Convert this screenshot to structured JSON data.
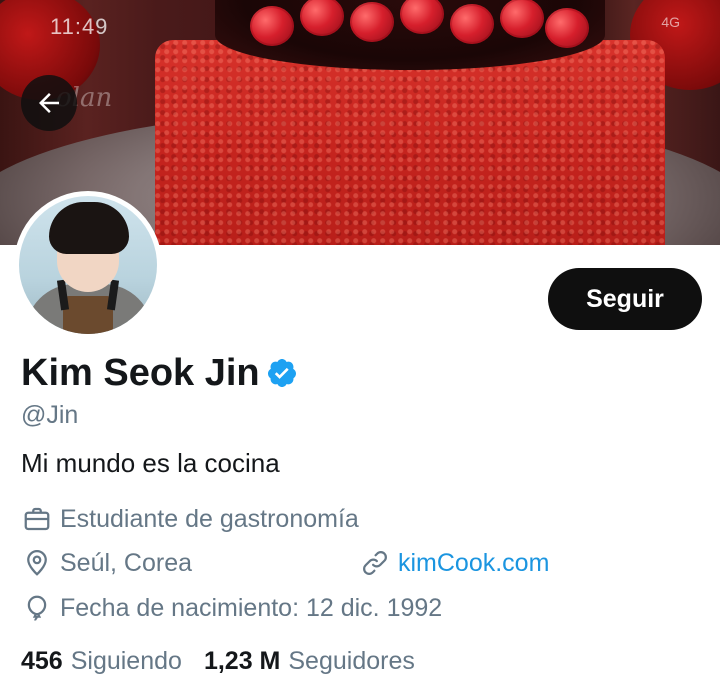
{
  "status_bar": {
    "time": "11:49",
    "signal": "4G"
  },
  "banner": {
    "watermark": "olan"
  },
  "header": {
    "back_icon": "arrow-left-icon"
  },
  "profile": {
    "name": "Kim Seok Jin",
    "verified_icon": "verified-badge-icon",
    "handle": "@Jin",
    "bio": "Mi mundo es la cocina",
    "follow_label": "Seguir",
    "occupation": "Estudiante de gastronomía",
    "location": "Seúl, Corea",
    "website": "kimCook.com",
    "birthdate": "Fecha de nacimiento: 12 dic. 1992"
  },
  "stats": {
    "following_count": "456",
    "following_label": "Siguiendo",
    "followers_count": "1,23 M",
    "followers_label": "Seguidores"
  },
  "colors": {
    "accent": "#1b95e0",
    "verified": "#1da1f2",
    "text_primary": "#14171a",
    "text_secondary": "#657786",
    "button_bg": "#0f0f0f"
  }
}
